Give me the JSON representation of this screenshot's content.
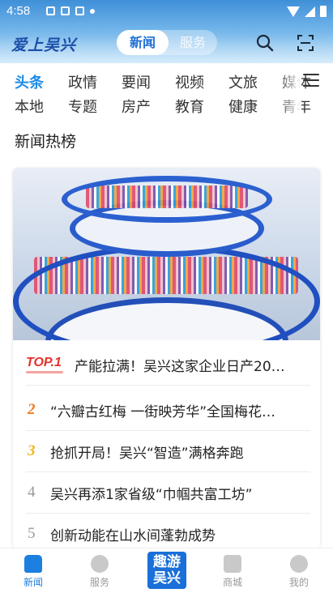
{
  "status_bar": {
    "time": "4:58"
  },
  "header": {
    "logo": "爱上吴兴",
    "segments": [
      "新闻",
      "服务"
    ],
    "active_segment": "新闻",
    "accent": "#1d8be8"
  },
  "categories": {
    "row1": [
      "头条",
      "政情",
      "要闻",
      "视频",
      "文旅",
      "媒体"
    ],
    "row2": [
      "本地",
      "专题",
      "房产",
      "教育",
      "健康",
      "青年"
    ],
    "active": "头条"
  },
  "section": {
    "title": "新闻热榜"
  },
  "hot_list": [
    {
      "rank_label": "TOP.1",
      "text": "产能拉满！吴兴这家企业日产20…",
      "color": "#e4312b"
    },
    {
      "rank_label": "2",
      "text": "“六瓣古红梅 一街映芳华”全国梅花…",
      "color": "#f07b1d"
    },
    {
      "rank_label": "3",
      "text": "抢抓开局！吴兴“智造”满格奔跑",
      "color": "#f2b41c"
    },
    {
      "rank_label": "4",
      "text": "吴兴再添1家省级“巾帼共富工坊”",
      "color": "#999999"
    },
    {
      "rank_label": "5",
      "text": "创新动能在山水间蓬勃成势",
      "color": "#999999"
    }
  ],
  "tabbar": {
    "items": [
      "新闻",
      "服务",
      "",
      "商城",
      "我的"
    ],
    "center_logo_line1": "趣游",
    "center_logo_line2": "吴兴",
    "active": "新闻"
  }
}
